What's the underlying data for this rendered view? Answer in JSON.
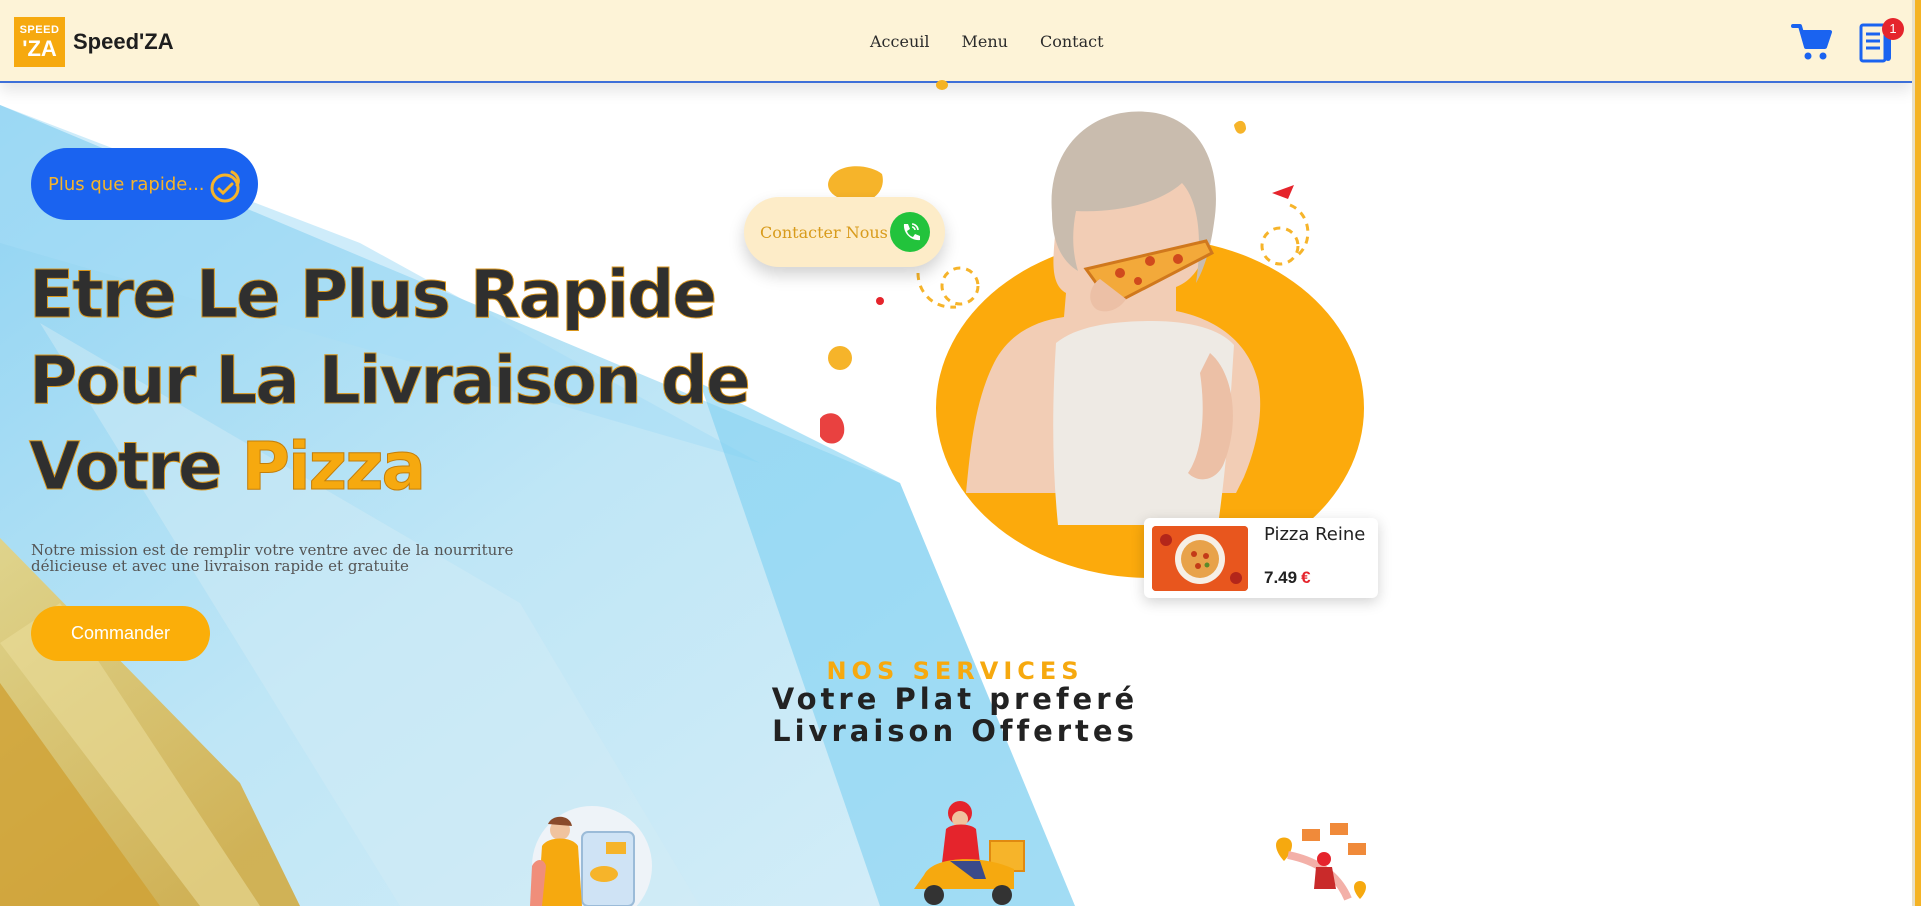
{
  "header": {
    "logo_line1": "SPEED",
    "logo_line2": "'ZA",
    "brand": "Speed'ZA",
    "nav": [
      "Acceuil",
      "Menu",
      "Contact"
    ],
    "cart_badge": "1"
  },
  "hero": {
    "tagline": "Plus que rapide...",
    "headline_line1": "Etre Le Plus Rapide",
    "headline_line2": "Pour La Livraison de",
    "headline_line3_prefix": "Votre ",
    "headline_accent": "Pizza",
    "mission": "Notre mission est de remplir votre ventre avec de la nourriture délicieuse et avec une livraison rapide et gratuite",
    "cta": "Commander",
    "contact_cta": "Contacter Nous"
  },
  "featured_product": {
    "name": "Pizza Reine",
    "price": "7.49",
    "currency": "€"
  },
  "services": {
    "kicker": "NOS SERVICES",
    "title_line1": "Votre Plat preferé",
    "title_line2": "Livraison Offertes"
  },
  "icons": [
    "logo-icon",
    "cart-icon",
    "orders-icon",
    "timer-icon",
    "phone-icon"
  ],
  "colors": {
    "header_bg": "#fdf3d7",
    "accent": "#f6a90f",
    "blue": "#1a63f0",
    "green": "#22c33c",
    "red": "#e5242c"
  }
}
